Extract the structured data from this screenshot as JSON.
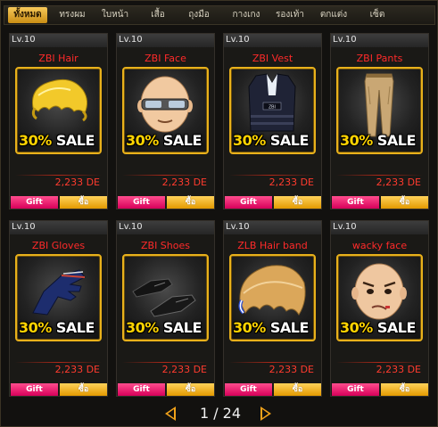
{
  "tabs": [
    {
      "label": "ทั้งหมด",
      "active": true
    },
    {
      "label": "ทรงผม",
      "active": false
    },
    {
      "label": "ใบหน้า",
      "active": false
    },
    {
      "label": "เสื้อ",
      "active": false
    },
    {
      "label": "ถุงมือ",
      "active": false
    },
    {
      "label": "กางเกง",
      "active": false
    },
    {
      "label": "รองเท้า",
      "active": false
    },
    {
      "label": "ตกแต่ง",
      "active": false
    },
    {
      "label": "เซ็ต",
      "active": false
    }
  ],
  "items": [
    {
      "level": "Lv.10",
      "name": "ZBI Hair",
      "sale_pct": "30%",
      "sale_word": "SALE",
      "price": "2,233 DE",
      "gift": "Gift",
      "buy": "ซื้อ",
      "icon": "blonde-hair-icon"
    },
    {
      "level": "Lv.10",
      "name": "ZBI Face",
      "sale_pct": "30%",
      "sale_word": "SALE",
      "price": "2,233 DE",
      "gift": "Gift",
      "buy": "ซื้อ",
      "icon": "bald-face-goggles-icon"
    },
    {
      "level": "Lv.10",
      "name": "ZBI Vest",
      "sale_pct": "30%",
      "sale_word": "SALE",
      "price": "2,233 DE",
      "gift": "Gift",
      "buy": "ซื้อ",
      "icon": "vest-icon"
    },
    {
      "level": "Lv.10",
      "name": "ZBI Pants",
      "sale_pct": "30%",
      "sale_word": "SALE",
      "price": "2,233 DE",
      "gift": "Gift",
      "buy": "ซื้อ",
      "icon": "pants-icon"
    },
    {
      "level": "Lv.10",
      "name": "ZBI Gloves",
      "sale_pct": "30%",
      "sale_word": "SALE",
      "price": "2,233 DE",
      "gift": "Gift",
      "buy": "ซื้อ",
      "icon": "glove-icon"
    },
    {
      "level": "Lv.10",
      "name": "ZBI Shoes",
      "sale_pct": "30%",
      "sale_word": "SALE",
      "price": "2,233 DE",
      "gift": "Gift",
      "buy": "ซื้อ",
      "icon": "shoes-icon"
    },
    {
      "level": "Lv.10",
      "name": "ZLB Hair band",
      "sale_pct": "30%",
      "sale_word": "SALE",
      "price": "2,233 DE",
      "gift": "Gift",
      "buy": "ซื้อ",
      "icon": "hair-band-icon"
    },
    {
      "level": "Lv.10",
      "name": "wacky face",
      "sale_pct": "30%",
      "sale_word": "SALE",
      "price": "2,233 DE",
      "gift": "Gift",
      "buy": "ซื้อ",
      "icon": "wacky-face-icon"
    }
  ],
  "pager": {
    "text": "1 / 24",
    "current": 1,
    "total": 24
  },
  "colors": {
    "accent": "#f0a21a",
    "price": "#ff3b2e",
    "gift": "#e2006a",
    "buy": "#f5ad0c"
  }
}
